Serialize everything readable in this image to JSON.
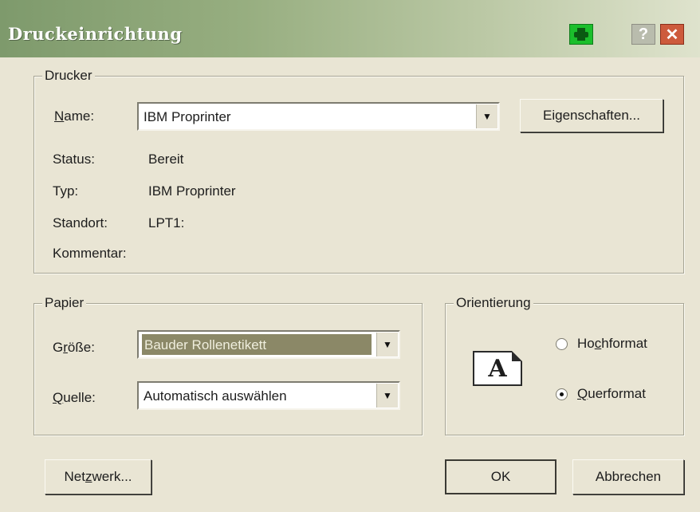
{
  "window": {
    "title": "Druckeinrichtung"
  },
  "titlebar_buttons": {
    "help": "?",
    "close": "✕"
  },
  "printer": {
    "legend": "Drucker",
    "name_label": "Name:",
    "name_value": "IBM Proprinter",
    "properties_button": "Eigenschaften...",
    "status_label": "Status:",
    "status_value": "Bereit",
    "type_label": "Typ:",
    "type_value": "IBM Proprinter",
    "location_label": "Standort:",
    "location_value": "LPT1:",
    "comment_label": "Kommentar:"
  },
  "paper": {
    "legend": "Papier",
    "size_label": "Größe:",
    "size_value": "Bauder Rollenetikett",
    "source_label": "Quelle:",
    "source_value": "Automatisch auswählen"
  },
  "orientation": {
    "legend": "Orientierung",
    "icon_letter": "A",
    "portrait_label": "Hochformat",
    "landscape_label": "Querformat",
    "selected": "Querformat"
  },
  "buttons": {
    "network": "Netzwerk...",
    "ok": "OK",
    "cancel": "Abbrechen"
  },
  "colors": {
    "titlebar_start": "#7e9a6c",
    "dialog_bg": "#e9e5d4",
    "selection_bg": "#8b8867",
    "close": "#cd5a3c",
    "printer_icon": "#1bbf2c"
  },
  "icons": {
    "printer": "printer-icon",
    "help": "help-icon",
    "close": "close-icon",
    "dropdown": "chevron-down-icon"
  }
}
